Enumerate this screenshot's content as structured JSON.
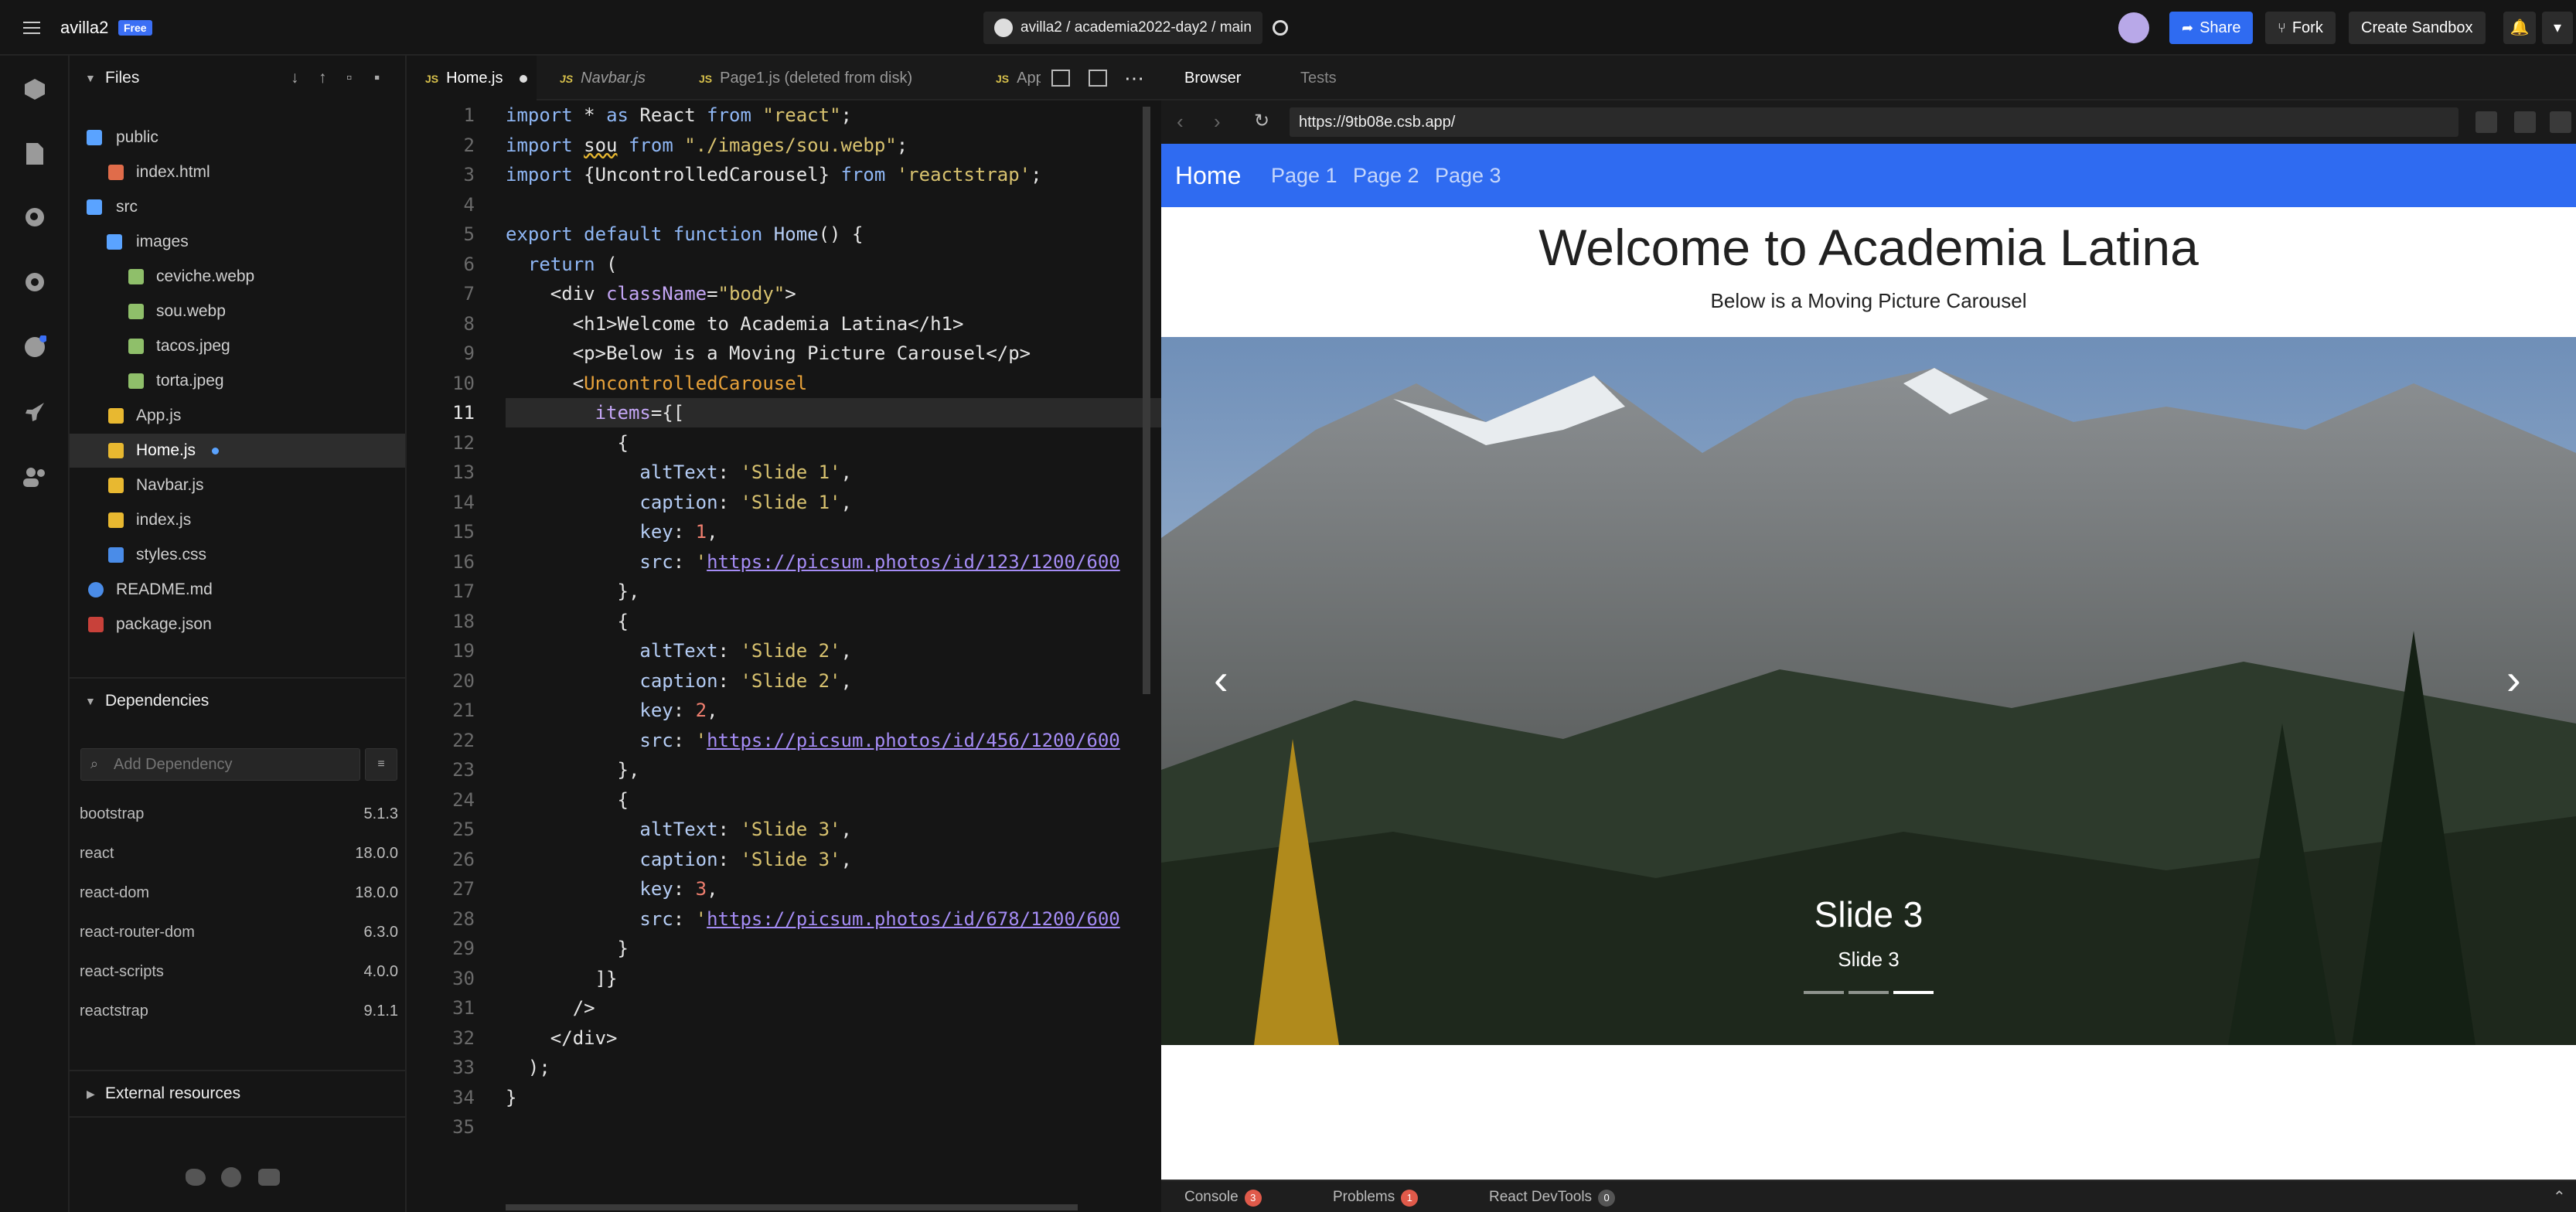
{
  "topbar": {
    "user": "avilla2",
    "plan": "Free",
    "repo_path": "avilla2 / academia2022-day2 / main",
    "share_label": "Share",
    "fork_label": "Fork",
    "create_label": "Create Sandbox"
  },
  "sidebar": {
    "files_title": "Files",
    "tree": [
      {
        "name": "public",
        "type": "folder"
      },
      {
        "name": "index.html",
        "type": "html"
      },
      {
        "name": "src",
        "type": "folder"
      },
      {
        "name": "images",
        "type": "folder"
      },
      {
        "name": "ceviche.webp",
        "type": "image"
      },
      {
        "name": "sou.webp",
        "type": "image"
      },
      {
        "name": "tacos.jpeg",
        "type": "image"
      },
      {
        "name": "torta.jpeg",
        "type": "image"
      },
      {
        "name": "App.js",
        "type": "js"
      },
      {
        "name": "Home.js",
        "type": "js"
      },
      {
        "name": "Navbar.js",
        "type": "js"
      },
      {
        "name": "index.js",
        "type": "js"
      },
      {
        "name": "styles.css",
        "type": "css"
      },
      {
        "name": "README.md",
        "type": "md"
      },
      {
        "name": "package.json",
        "type": "json"
      }
    ],
    "dependencies_title": "Dependencies",
    "add_dependency_placeholder": "Add Dependency",
    "dependencies": [
      {
        "name": "bootstrap",
        "version": "5.1.3"
      },
      {
        "name": "react",
        "version": "18.0.0"
      },
      {
        "name": "react-dom",
        "version": "18.0.0"
      },
      {
        "name": "react-router-dom",
        "version": "6.3.0"
      },
      {
        "name": "react-scripts",
        "version": "4.0.0"
      },
      {
        "name": "reactstrap",
        "version": "9.1.1"
      }
    ],
    "external_title": "External resources"
  },
  "editor": {
    "tabs": [
      {
        "label": "Home.js",
        "note": "active, unsaved"
      },
      {
        "label": "Navbar.js",
        "note": "preview"
      },
      {
        "label": "Page1.js (deleted from disk)",
        "note": ""
      },
      {
        "label": "App.j",
        "note": ""
      }
    ],
    "line_numbers": [
      "1",
      "2",
      "3",
      "4",
      "5",
      "6",
      "7",
      "8",
      "9",
      "10",
      "11",
      "12",
      "13",
      "14",
      "15",
      "16",
      "17",
      "18",
      "19",
      "20",
      "21",
      "22",
      "23",
      "24",
      "25",
      "26",
      "27",
      "28",
      "29",
      "30",
      "31",
      "32",
      "33",
      "34",
      "35"
    ]
  },
  "browser": {
    "tab_browser": "Browser",
    "tab_tests": "Tests",
    "url": "https://9tb08e.csb.app/",
    "nav_brand": "Home",
    "nav_links": [
      "Page 1",
      "Page 2",
      "Page 3"
    ],
    "heading": "Welcome to Academia Latina",
    "subheading": "Below is a Moving Picture Carousel",
    "slide_title": "Slide 3",
    "slide_caption": "Slide 3",
    "slide_count": 3,
    "active_slide": 3
  },
  "console": {
    "console_label": "Console",
    "console_count": "3",
    "problems_label": "Problems",
    "problems_count": "1",
    "devtools_label": "React DevTools",
    "devtools_count": "0"
  }
}
